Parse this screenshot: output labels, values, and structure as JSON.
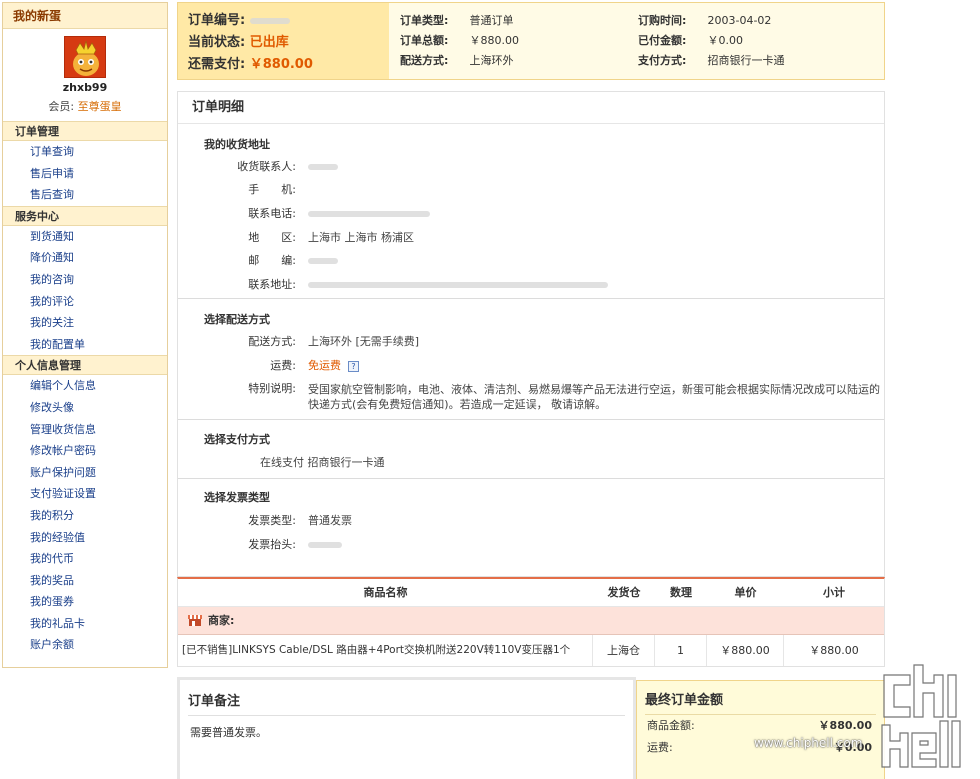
{
  "sidebar": {
    "title": "我的新蛋",
    "username": "zhxb99",
    "member_label": "会员:",
    "member_rank": "至尊蛋皇",
    "groups": [
      {
        "title": "订单管理",
        "items": [
          "订单查询",
          "售后申请",
          "售后查询"
        ]
      },
      {
        "title": "服务中心",
        "items": [
          "到货通知",
          "降价通知",
          "我的咨询",
          "我的评论",
          "我的关注",
          "我的配置单"
        ]
      },
      {
        "title": "个人信息管理",
        "items": [
          "编辑个人信息",
          "修改头像",
          "管理收货信息",
          "修改帐户密码",
          "账户保护问题",
          "支付验证设置",
          "我的积分",
          "我的经验值",
          "我的代币",
          "我的奖品",
          "我的蛋券",
          "我的礼品卡",
          "账户余额"
        ]
      }
    ]
  },
  "summary": {
    "order_no_label": "订单编号:",
    "status_label": "当前状态:",
    "status_value": "已出库",
    "due_label": "还需支付:",
    "due_value": "￥880.00",
    "order_type_label": "订单类型:",
    "order_type_value": "普通订单",
    "order_total_label": "订单总额:",
    "order_total_value": "￥880.00",
    "delivery_label": "配送方式:",
    "delivery_value": "上海环外",
    "order_time_label": "订购时间:",
    "order_time_value": "2003-04-02",
    "paid_label": "已付金额:",
    "paid_value": "￥0.00",
    "pay_method_label": "支付方式:",
    "pay_method_value": "招商银行一卡通"
  },
  "detail": {
    "title": "订单明细",
    "address": {
      "title": "我的收货地址",
      "contact_label": "收货联系人:",
      "mobile_label": "手　　机:",
      "phone_label": "联系电话:",
      "region_label": "地　　区:",
      "region_value": "上海市 上海市 杨浦区",
      "zip_label": "邮　　编:",
      "addr_label": "联系地址:"
    },
    "shipping": {
      "title": "选择配送方式",
      "method_label": "配送方式:",
      "method_value": "上海环外 [无需手续费]",
      "fee_label": "运费:",
      "fee_value": "免运费",
      "note_label": "特别说明:",
      "note_value": "受国家航空管制影响，电池、液体、清洁剂、易燃易爆等产品无法进行空运，新蛋可能会根据实际情况改成可以陆运的快递方式(会有免费短信通知)。若造成一定延误， 敬请谅解。"
    },
    "payment": {
      "title": "选择支付方式",
      "value": "在线支付 招商银行一卡通"
    },
    "invoice": {
      "title": "选择发票类型",
      "type_label": "发票类型:",
      "type_value": "普通发票",
      "head_label": "发票抬头:"
    }
  },
  "products": {
    "headers": [
      "商品名称",
      "发货仓",
      "数理",
      "单价",
      "小计"
    ],
    "merchant_label": "商家:",
    "rows": [
      {
        "name": "[已不销售]LINKSYS Cable/DSL 路由器+4Port交换机附送220V转110V变压器1个",
        "warehouse": "上海仓",
        "qty": "1",
        "price": "￥880.00",
        "subtotal": "￥880.00"
      }
    ]
  },
  "notes": {
    "title": "订单备注",
    "text": "需要普通发票。"
  },
  "final": {
    "title": "最终订单金额",
    "goods_label": "商品金额:",
    "goods_value": "￥880.00",
    "freight_label": "运费:",
    "freight_value": "￥0.00"
  },
  "watermark": {
    "text": "www.chiphell.com",
    "logo": "chip hell"
  },
  "colors": {
    "accent_orange": "#e05a00",
    "link_blue": "#1a3f8a",
    "panel_yellow": "#fffbe6",
    "header_yellow": "#fff2cf"
  },
  "icons": {
    "help": "question-mark-icon",
    "store": "store-awning-icon"
  }
}
